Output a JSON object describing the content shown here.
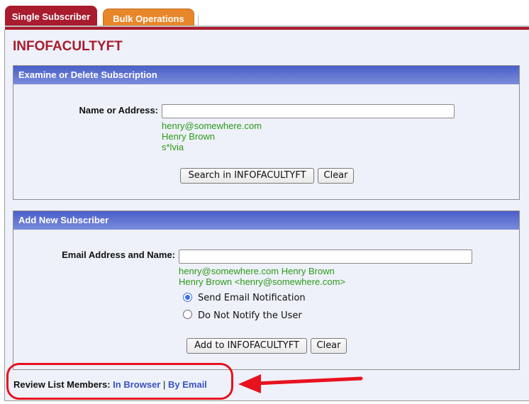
{
  "tabs": [
    {
      "label": "Single Subscriber",
      "active": true
    },
    {
      "label": "Bulk Operations",
      "active": false
    }
  ],
  "list_name": "INFOFACULTYFT",
  "examine": {
    "header": "Examine or Delete Subscription",
    "field_label": "Name or Address:",
    "field_value": "",
    "hints": [
      "henry@somewhere.com",
      "Henry Brown",
      "s*lvia"
    ],
    "search_button": "Search in INFOFACULTYFT",
    "clear_button": "Clear"
  },
  "add": {
    "header": "Add New Subscriber",
    "field_label": "Email Address and Name:",
    "field_value": "",
    "hints": [
      "henry@somewhere.com Henry Brown",
      "Henry Brown <henry@somewhere.com>"
    ],
    "options": [
      {
        "label": "Send Email Notification",
        "selected": true
      },
      {
        "label": "Do Not Notify the User",
        "selected": false
      }
    ],
    "add_button": "Add to INFOFACULTYFT",
    "clear_button": "Clear"
  },
  "review": {
    "label": "Review List Members:",
    "links": [
      "In Browser",
      "By Email"
    ],
    "separator": "|"
  },
  "colors": {
    "brand_red": "#a81c2e",
    "tab_orange": "#e8862a",
    "header_blue": "#4a5ec9",
    "hint_green": "#2c9a1a",
    "link_blue": "#3a52c4",
    "annotation_red": "#e8121f"
  }
}
